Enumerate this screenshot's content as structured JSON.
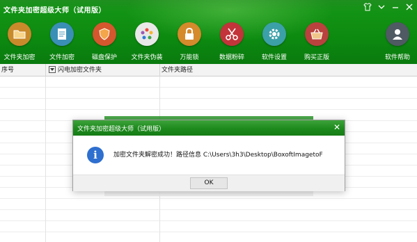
{
  "window": {
    "title": "文件夹加密超级大师（试用版）",
    "controls": [
      "shirt-icon",
      "menu-icon",
      "minimize-icon",
      "close-icon"
    ]
  },
  "toolbar": {
    "items": [
      {
        "label": "文件夹加密",
        "icon": "folder-lock-icon",
        "color": "#c98a2c"
      },
      {
        "label": "文件加密",
        "icon": "file-lock-icon",
        "color": "#3a8fb6"
      },
      {
        "label": "磁盘保护",
        "icon": "shield-icon",
        "color": "#d4572e"
      },
      {
        "label": "文件夹伪装",
        "icon": "palette-icon",
        "color": "#e8e8e8"
      },
      {
        "label": "万能锁",
        "icon": "padlock-icon",
        "color": "#d58a2b"
      },
      {
        "label": "数据粉碎",
        "icon": "scissors-icon",
        "color": "#c2343a"
      },
      {
        "label": "软件设置",
        "icon": "gear-icon",
        "color": "#3ca0a8"
      },
      {
        "label": "购买正版",
        "icon": "basket-icon",
        "color": "#b9423e"
      },
      {
        "label": "软件帮助",
        "icon": "user-icon",
        "color": "#4f5a63"
      }
    ]
  },
  "grid": {
    "headers": [
      "序号",
      "闪电加密文件夹",
      "文件夹路径"
    ]
  },
  "dialog": {
    "title": "文件夹加密超级大师（试用版）",
    "message": "加密文件夹解密成功！路径信息  C:\\Users\\3h3\\Desktop\\BoxoftImagetoF",
    "ok_label": "OK"
  }
}
